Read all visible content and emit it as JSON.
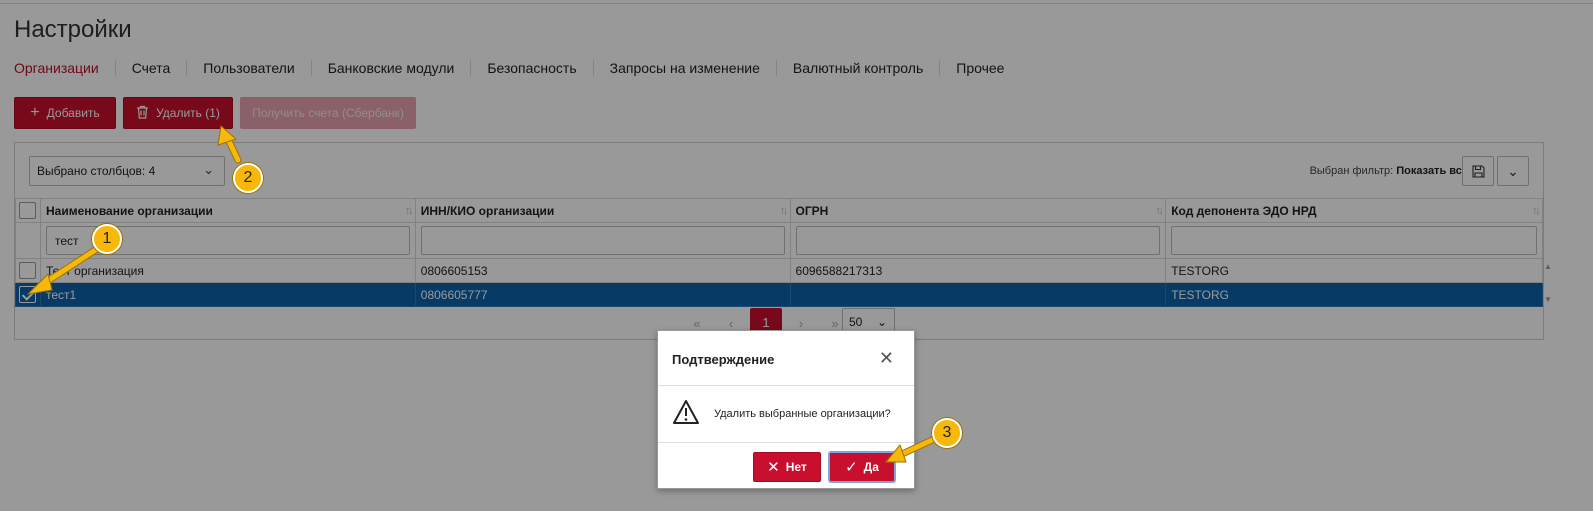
{
  "page": {
    "title": "Настройки"
  },
  "tabs": [
    {
      "label": "Организации",
      "active": true
    },
    {
      "label": "Счета"
    },
    {
      "label": "Пользователи"
    },
    {
      "label": "Банковские модули"
    },
    {
      "label": "Безопасность"
    },
    {
      "label": "Запросы на изменение"
    },
    {
      "label": "Валютный контроль"
    },
    {
      "label": "Прочее"
    }
  ],
  "toolbar": {
    "add_label": "Добавить",
    "delete_label": "Удалить (1)",
    "get_accounts_label": "Получить счета (Сбербанк)"
  },
  "grid": {
    "columns_selector": "Выбрано столбцов: 4",
    "filter_prefix": "Выбран фильтр:",
    "filter_value": "Показать всё",
    "headers": [
      "Наименование организации",
      "ИНН/КИО организации",
      "ОГРН",
      "Код депонента ЭДО НРД"
    ],
    "filters": [
      "тест",
      "",
      "",
      ""
    ],
    "rows": [
      {
        "cells": [
          "Тест организация",
          "0806605153",
          "6096588217313",
          "TESTORG"
        ],
        "selected": false
      },
      {
        "cells": [
          "тест1",
          "0806605777",
          "",
          "TESTORG"
        ],
        "selected": true
      }
    ],
    "pager": {
      "first": "«",
      "prev": "‹",
      "current": "1",
      "next": "›",
      "last": "»",
      "page_size": "50"
    }
  },
  "dialog": {
    "title": "Подтверждение",
    "message": "Удалить выбранные организации?",
    "no_label": "Нет",
    "yes_label": "Да"
  },
  "annotations": {
    "badge1": "1",
    "badge2": "2",
    "badge3": "3"
  },
  "colors": {
    "accent": "#c8102e",
    "selection": "#0d61a8",
    "callout": "#f7b80a"
  }
}
